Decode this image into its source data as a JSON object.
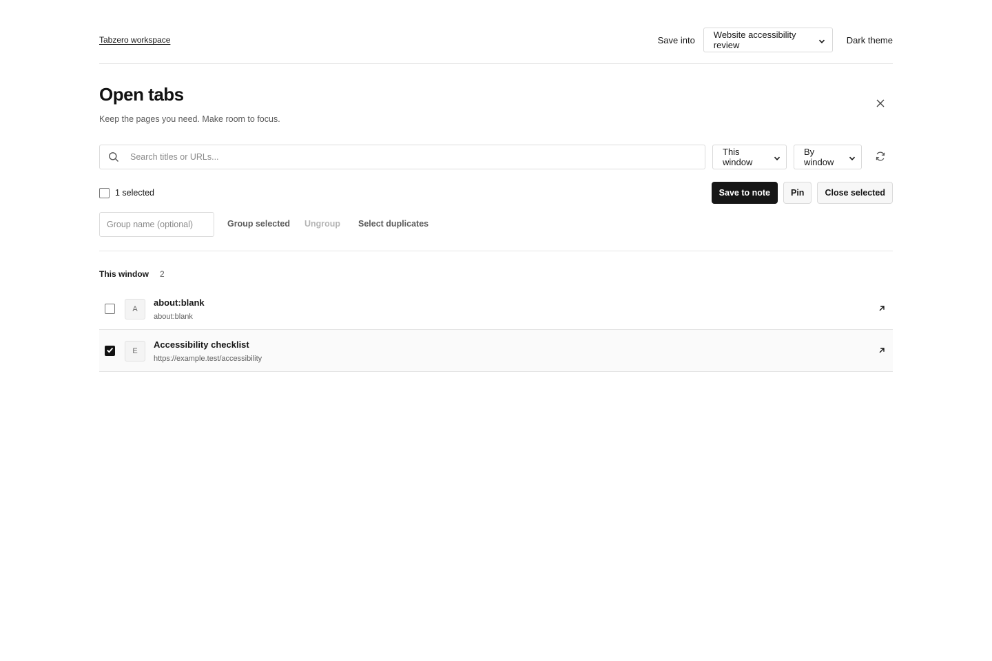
{
  "header": {
    "workspace_link": "Tabzero workspace",
    "save_into_label": "Save into",
    "save_into_value": "Website accessibility review",
    "theme_toggle": "Dark theme"
  },
  "title": "Open tabs",
  "subtitle": "Keep the pages you need. Make room to focus.",
  "search": {
    "placeholder": "Search titles or URLs..."
  },
  "filters": {
    "scope_value": "This window",
    "grouping_value": "By window"
  },
  "selection": {
    "count_label": "1 selected",
    "save_button": "Save to note",
    "pin_button": "Pin",
    "close_button": "Close selected"
  },
  "grouping": {
    "group_name_placeholder": "Group name (optional)",
    "group_selected": "Group selected",
    "ungroup": "Ungroup",
    "select_duplicates": "Select duplicates"
  },
  "group": {
    "title": "This window",
    "count": "2",
    "tabs": [
      {
        "favicon_letter": "A",
        "title": "about:blank",
        "url": "about:blank",
        "selected": false
      },
      {
        "favicon_letter": "E",
        "title": "Accessibility checklist",
        "url": "https://example.test/accessibility",
        "selected": true
      }
    ]
  },
  "icons": {
    "close": "close-icon",
    "search": "search-icon",
    "refresh": "refresh-icon",
    "chevron": "chevron-down-icon",
    "open": "arrow-up-right-icon",
    "check": "check-icon"
  },
  "colors": {
    "primary": "#161616",
    "border": "#dcdcdc",
    "muted_text": "#5a5a5a",
    "disabled_text": "#b5b5b5"
  }
}
